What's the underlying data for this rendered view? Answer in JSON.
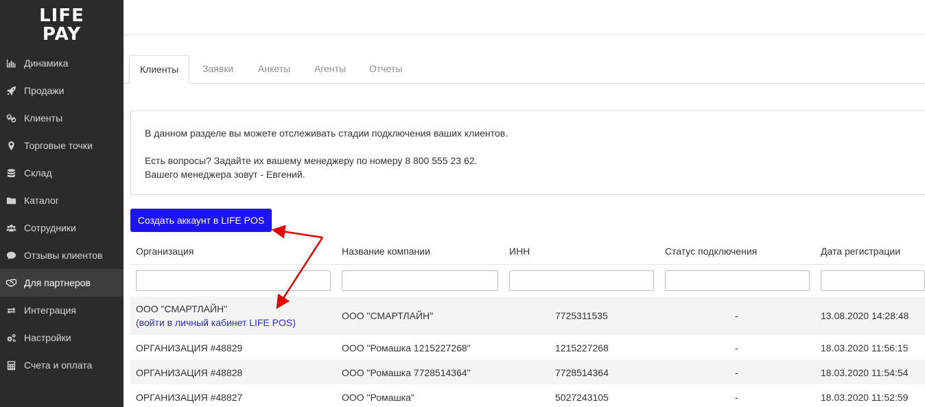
{
  "sidebar": {
    "logo_line1": "LIFE",
    "logo_line2": "PAY",
    "items": [
      {
        "label": "Динамика",
        "icon": "bar-chart-icon"
      },
      {
        "label": "Продажи",
        "icon": "rocket-icon"
      },
      {
        "label": "Клиенты",
        "icon": "link-icon"
      },
      {
        "label": "Торговые точки",
        "icon": "map-marker-icon"
      },
      {
        "label": "Склад",
        "icon": "database-icon"
      },
      {
        "label": "Каталог",
        "icon": "folder-icon"
      },
      {
        "label": "Сотрудники",
        "icon": "users-icon"
      },
      {
        "label": "Отзывы клиентов",
        "icon": "comments-icon"
      },
      {
        "label": "Для партнеров",
        "icon": "handshake-icon"
      },
      {
        "label": "Интеграция",
        "icon": "exchange-icon"
      },
      {
        "label": "Настройки",
        "icon": "gears-icon"
      },
      {
        "label": "Счета и оплата",
        "icon": "calculator-icon"
      }
    ],
    "active_index": 8
  },
  "tabs": [
    "Клиенты",
    "Заявки",
    "Анкеты",
    "Агенты",
    "Отчеты"
  ],
  "info": {
    "line1": "В данном разделе вы можете отслеживать стадии подключения ваших клиентов.",
    "line2": "Есть вопросы? Задайте их вашему менеджеру по номеру 8 800 555 23 62.",
    "line3": "Вашего менеджера зовут - Евгений."
  },
  "create_button": "Создать аккаунт в LIFE POS",
  "table": {
    "headers": [
      "Организация",
      "Название компании",
      "ИНН",
      "Статус подключения",
      "Дата регистрации"
    ],
    "rows": [
      {
        "org": "ООО \"СМАРТЛАЙН\"",
        "link": "(войти в личный кабинет LIFE POS)",
        "company": "ООО \"СМАРТЛАЙН\"",
        "inn": "7725311535",
        "status": "-",
        "date": "13.08.2020 14:28:48"
      },
      {
        "org": "ОРГАНИЗАЦИЯ #48829",
        "link": "",
        "company": "ООО \"Ромашка 1215227268\"",
        "inn": "1215227268",
        "status": "-",
        "date": "18.03.2020 11:56:15"
      },
      {
        "org": "ОРГАНИЗАЦИЯ #48828",
        "link": "",
        "company": "ООО \"Ромашка 7728514364\"",
        "inn": "7728514364",
        "status": "-",
        "date": "18.03.2020 11:54:54"
      },
      {
        "org": "ОРГАНИЗАЦИЯ #48827",
        "link": "",
        "company": "ООО \"Ромашка\"",
        "inn": "5027243105",
        "status": "-",
        "date": "18.03.2020 11:52:59"
      }
    ]
  },
  "colors": {
    "sidebar_bg": "#2b2b2b",
    "button_bg": "#1e14f0",
    "link": "#2b2bd4",
    "arrow": "#e60000"
  }
}
